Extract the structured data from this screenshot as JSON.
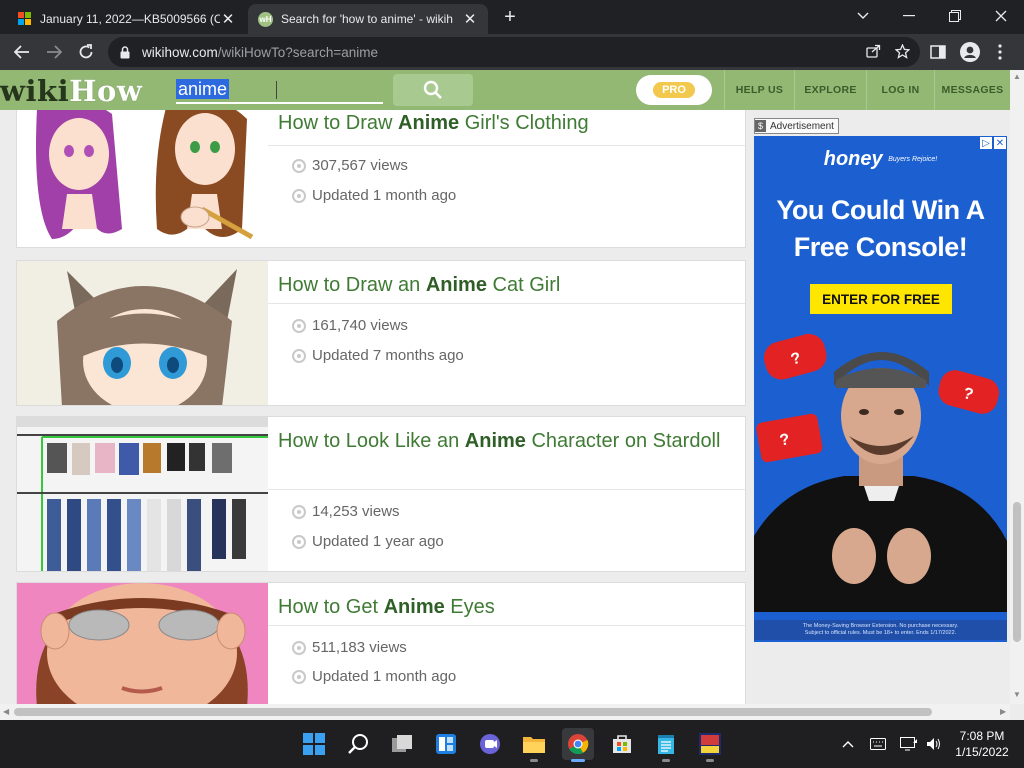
{
  "browser": {
    "tabs": [
      {
        "title": "January 11, 2022—KB5009566 (OS",
        "favicon": "microsoft-logo-icon",
        "active": false
      },
      {
        "title": "Search for 'how to anime' - wikih",
        "favicon": "wikihow-favicon-icon",
        "active": true
      }
    ],
    "address": {
      "host": "wikihow.com",
      "path": "/wikiHowTo?search=anime"
    }
  },
  "site": {
    "logo": {
      "wiki": "wiki",
      "how": "How"
    },
    "search_query": "anime",
    "pro_label": "PRO",
    "nav": [
      "HELP US",
      "EXPLORE",
      "LOG IN",
      "MESSAGES"
    ]
  },
  "results": [
    {
      "title_pre": "How to Draw ",
      "title_bold": "Anime",
      "title_post": " Girl's Clothing",
      "views": "307,567 views",
      "updated": "Updated 1 month ago"
    },
    {
      "title_pre": "How to Draw an ",
      "title_bold": "Anime",
      "title_post": " Cat Girl",
      "views": "161,740 views",
      "updated": "Updated 7 months ago"
    },
    {
      "title_pre": "How to Look Like an ",
      "title_bold": "Anime",
      "title_post": " Character on Stardoll",
      "views": "14,253 views",
      "updated": "Updated 1 year ago"
    },
    {
      "title_pre": "How to Get ",
      "title_bold": "Anime",
      "title_post": " Eyes",
      "views": "511,183 views",
      "updated": "Updated 1 month ago"
    }
  ],
  "ad": {
    "label": "Advertisement",
    "brand": "honey",
    "brand_tagline": "Buyers Rejoice!",
    "headline_line1": "You Could Win A",
    "headline_line2": "Free Console!",
    "cta": "ENTER FOR FREE",
    "fine_line1": "The Money-Saving Browser Extension. No purchase necessary.",
    "fine_line2": "Subject to official rules. Must be 18+ to enter. Ends 1/17/2022."
  },
  "taskbar": {
    "time": "7:08 PM",
    "date": "1/15/2022"
  },
  "colors": {
    "wikihow_green": "#93b874",
    "title_green": "#3f7b34",
    "ad_blue": "#1b5fd0",
    "cta_yellow": "#ffe600"
  }
}
